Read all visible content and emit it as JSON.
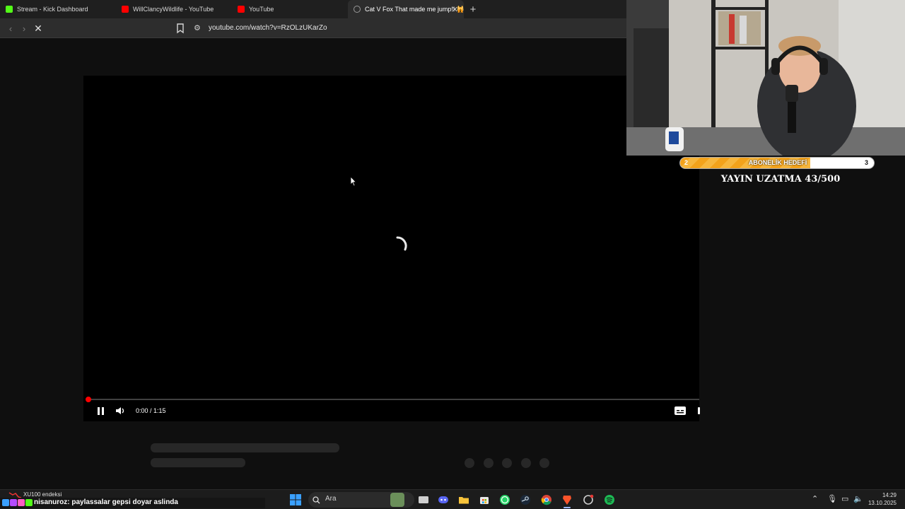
{
  "browser": {
    "tabs": [
      {
        "title": "Stream - Kick Dashboard",
        "favicon_color": "#53fc18"
      },
      {
        "title": "WillClancyWildlife - YouTube",
        "favicon_color": "#ff0000"
      },
      {
        "title": "YouTube",
        "favicon_color": "#ff0000"
      },
      {
        "title": "Cat V Fox That made me jump!! 🙀",
        "favicon_color": "#9a9a9a",
        "active": true
      }
    ],
    "new_tab_symbol": "+",
    "close_symbol": "✕",
    "url": "youtube.com/watch?v=RzOLzUKarZo"
  },
  "player": {
    "time": "0:00 / 1:15",
    "progress": 0.0,
    "state": "loading"
  },
  "stream_overlay": {
    "goal": {
      "start": "2",
      "label": "ABONELİK HEDEFİ",
      "end": "3",
      "progress": 0.67
    },
    "extend_text": "YAYIN UZATMA 43/500"
  },
  "taskbar": {
    "stock_label": "XU100 endeksi",
    "chat_user": "nisanuroz",
    "chat_message": ": paylassalar gepsi doyar aslinda",
    "search_placeholder": "Ara",
    "time": "14:29",
    "date": "13.10.2025"
  }
}
